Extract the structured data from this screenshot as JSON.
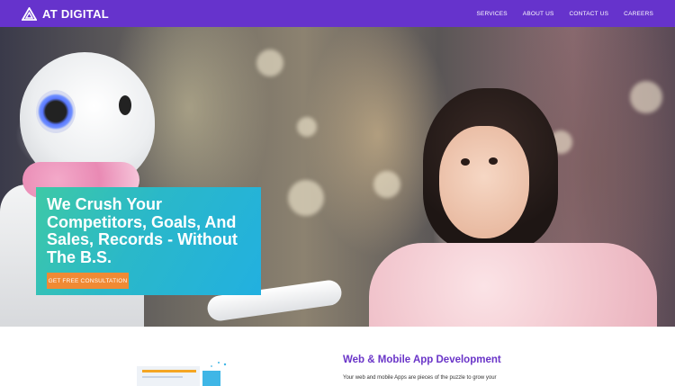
{
  "brand": {
    "name": "AT DIGITAL",
    "logo_icon": "triangle-logo-icon"
  },
  "nav": {
    "items": [
      {
        "label": "SERVICES"
      },
      {
        "label": "ABOUT US"
      },
      {
        "label": "CONTACT US"
      },
      {
        "label": "CAREERS"
      }
    ]
  },
  "hero": {
    "title": "We Crush Your Competitors, Goals, And Sales, Records - Without The B.S.",
    "cta_label": "GET FREE CONSULTATION",
    "image_description": "robot-and-child-photo"
  },
  "section": {
    "title": "Web & Mobile App Development",
    "text": "Your web and mobile Apps are pieces of the puzzle to grow your"
  },
  "colors": {
    "nav_bg": "#6633cc",
    "cta_bg": "#f08a34",
    "card_gradient_start": "#3ec9a6",
    "card_gradient_end": "#22b0e0",
    "section_title": "#6a35c8"
  }
}
